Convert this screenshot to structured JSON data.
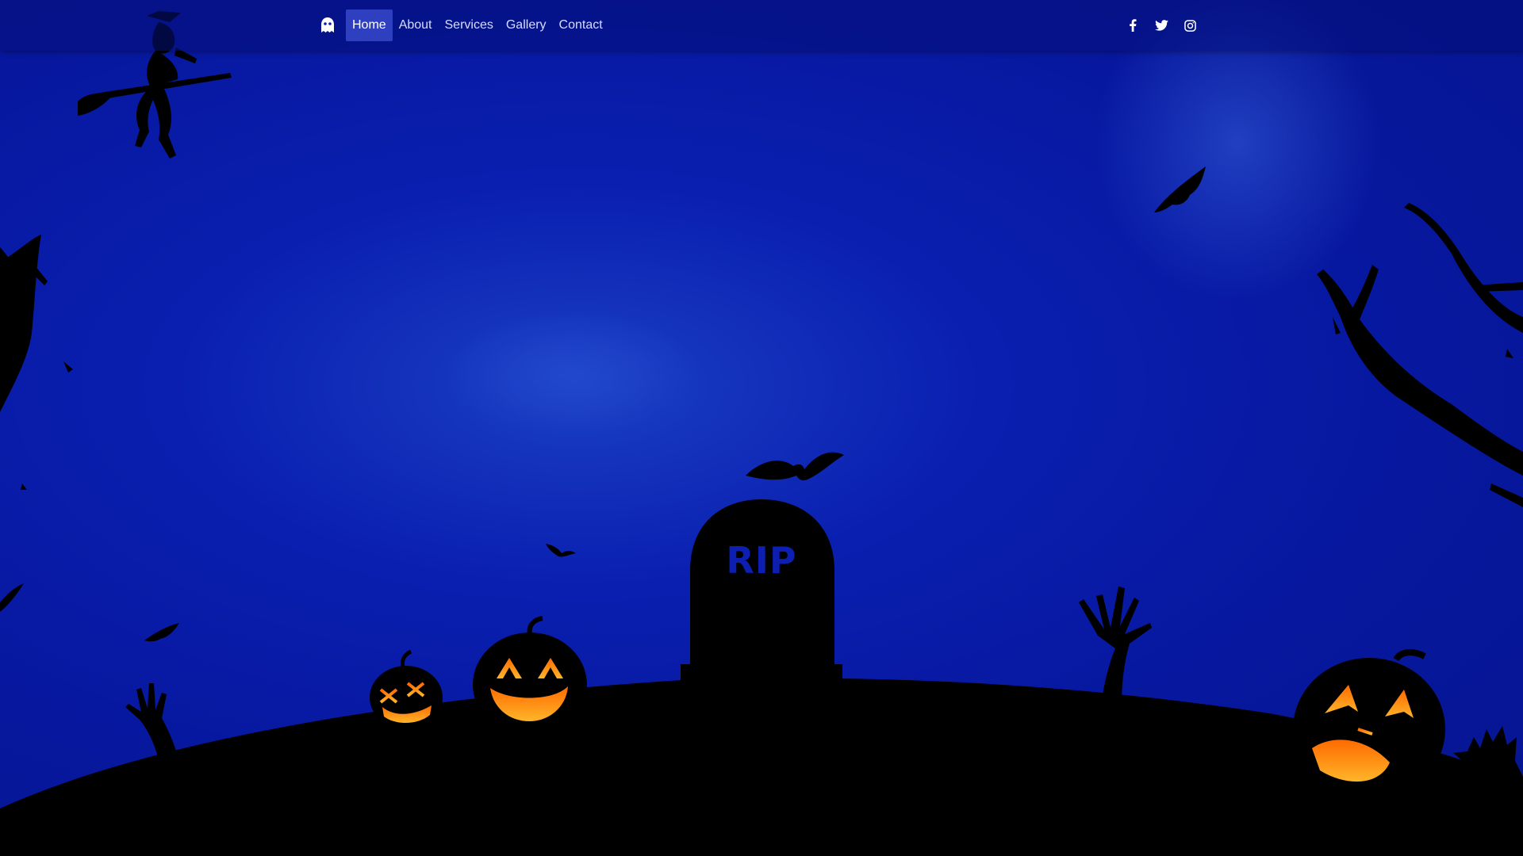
{
  "nav": {
    "brand_icon": "ghost-icon",
    "links": [
      {
        "label": "Home",
        "active": true
      },
      {
        "label": "About",
        "active": false
      },
      {
        "label": "Services",
        "active": false
      },
      {
        "label": "Gallery",
        "active": false
      },
      {
        "label": "Contact",
        "active": false
      }
    ],
    "social": [
      {
        "icon": "facebook-icon"
      },
      {
        "icon": "twitter-icon"
      },
      {
        "icon": "instagram-icon"
      }
    ]
  },
  "scene": {
    "tombstone_text": "RIP"
  },
  "colors": {
    "sky": "#0a1fb0",
    "silhouette": "#000000",
    "pumpkin_glow": "#ff9a1a",
    "nav_active": "#3c50d2"
  }
}
